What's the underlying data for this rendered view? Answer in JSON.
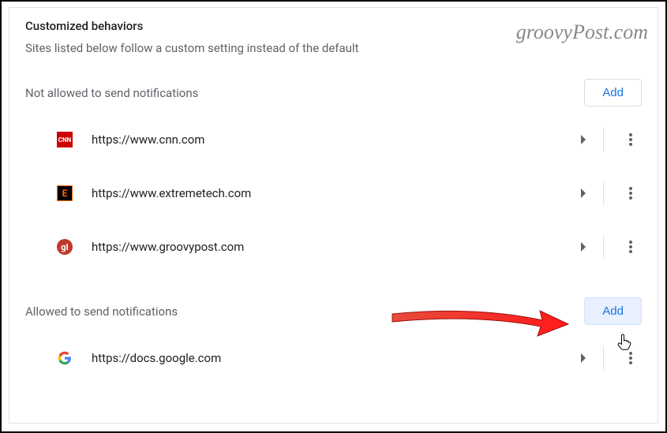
{
  "header": {
    "title": "Customized behaviors",
    "description": "Sites listed below follow a custom setting instead of the default"
  },
  "watermark": "groovyPost.com",
  "groups": {
    "not_allowed": {
      "label": "Not allowed to send notifications",
      "add_label": "Add",
      "sites": [
        {
          "url": "https://www.cnn.com",
          "icon": "cnn",
          "icon_text": "CNN"
        },
        {
          "url": "https://www.extremetech.com",
          "icon": "et",
          "icon_text": "E"
        },
        {
          "url": "https://www.groovypost.com",
          "icon": "gp",
          "icon_text": "gI"
        }
      ]
    },
    "allowed": {
      "label": "Allowed to send notifications",
      "add_label": "Add",
      "sites": [
        {
          "url": "https://docs.google.com",
          "icon": "google",
          "icon_text": "G"
        }
      ]
    }
  }
}
